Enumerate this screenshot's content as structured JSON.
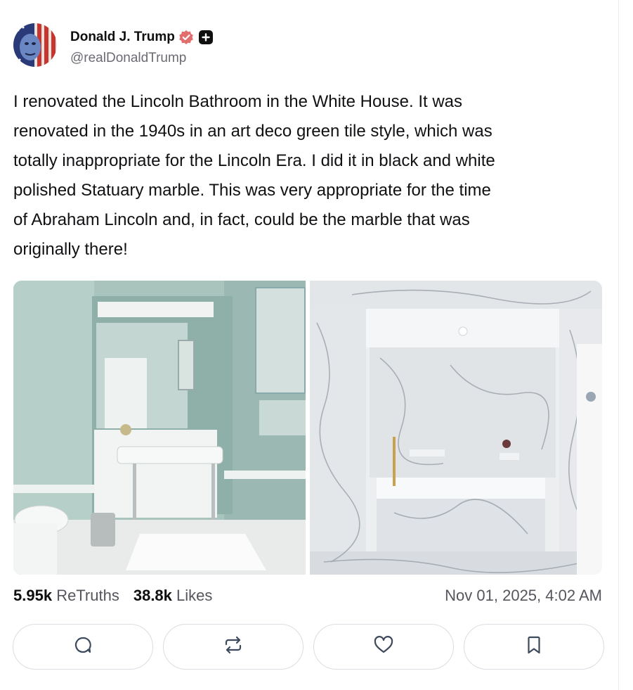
{
  "author": {
    "display_name": "Donald J. Trump",
    "handle": "@realDonaldTrump",
    "verified_icon": "verified-badge-icon",
    "plus_icon": "truth-plus-icon",
    "avatar": "avatar-image"
  },
  "post": {
    "text": "I renovated the Lincoln Bathroom in the White House. It was\nrenovated in the 1940s in an art deco green tile style, which was\ntotally inappropriate for the Lincoln Era. I did it in black and white\npolished Statuary marble. This was very appropriate for the time\nof Abraham Lincoln and, in fact, could be the marble that was\noriginally there!",
    "images": [
      "green-tile-bathroom-photo",
      "white-marble-bathroom-photo"
    ]
  },
  "stats": {
    "retruths_count": "5.95k",
    "retruths_label": "ReTruths",
    "likes_count": "38.8k",
    "likes_label": "Likes",
    "timestamp": "Nov 01, 2025, 4:02 AM"
  },
  "actions": [
    "reply-icon",
    "retruth-icon",
    "like-icon",
    "bookmark-icon"
  ],
  "colors": {
    "verified": "#e26d6d",
    "text": "#0f0f10",
    "muted": "#6b6b74",
    "border": "#dcdce2"
  }
}
